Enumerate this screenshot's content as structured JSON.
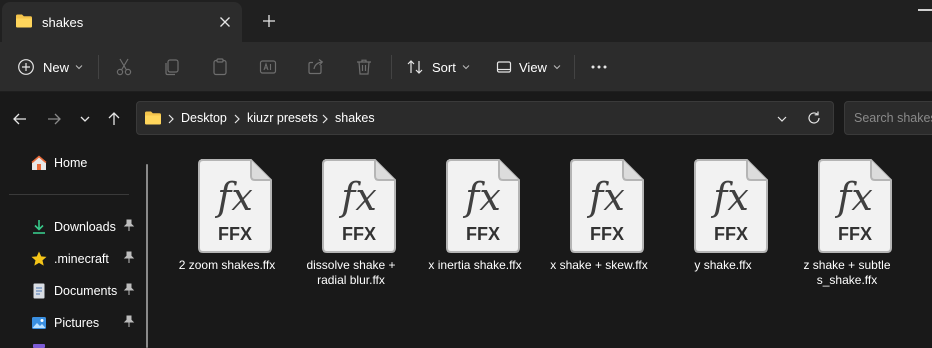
{
  "tab": {
    "title": "shakes",
    "close_icon": "close-icon",
    "new_tab_icon": "plus-icon"
  },
  "toolbar": {
    "new_label": "New",
    "sort_label": "Sort",
    "view_label": "View",
    "more_label": "..."
  },
  "address": {
    "crumbs": [
      "Desktop",
      "kiuzr presets",
      "shakes"
    ]
  },
  "search": {
    "placeholder": "Search shakes"
  },
  "sidebar": {
    "items": [
      {
        "label": "Home",
        "icon": "home-icon"
      },
      {
        "label": "Downloads",
        "icon": "download-icon",
        "pinned": true
      },
      {
        "label": ".minecraft",
        "icon": "star-icon",
        "pinned": true
      },
      {
        "label": "Documents",
        "icon": "document-icon",
        "pinned": true
      },
      {
        "label": "Pictures",
        "icon": "pictures-icon",
        "pinned": true
      }
    ]
  },
  "files": [
    {
      "line1": "2 zoom shakes.ffx",
      "line2": "",
      "glyph": "fx",
      "ext": "FFX"
    },
    {
      "line1": "dissolve shake +",
      "line2": "radial blur.ffx",
      "glyph": "fx",
      "ext": "FFX"
    },
    {
      "line1": "x inertia shake.ffx",
      "line2": "",
      "glyph": "fx",
      "ext": "FFX"
    },
    {
      "line1": "x shake + skew.ffx",
      "line2": "",
      "glyph": "fx",
      "ext": "FFX"
    },
    {
      "line1": "y shake.ffx",
      "line2": "",
      "glyph": "fx",
      "ext": "FFX"
    },
    {
      "line1": "z shake + subtle",
      "line2": "s_shake.ffx",
      "glyph": "fx",
      "ext": "FFX"
    }
  ],
  "colors": {
    "accent": "#4cc2ff",
    "folder": "#f4c44c",
    "background": "#191919",
    "toolbar": "#2c2c2c"
  }
}
